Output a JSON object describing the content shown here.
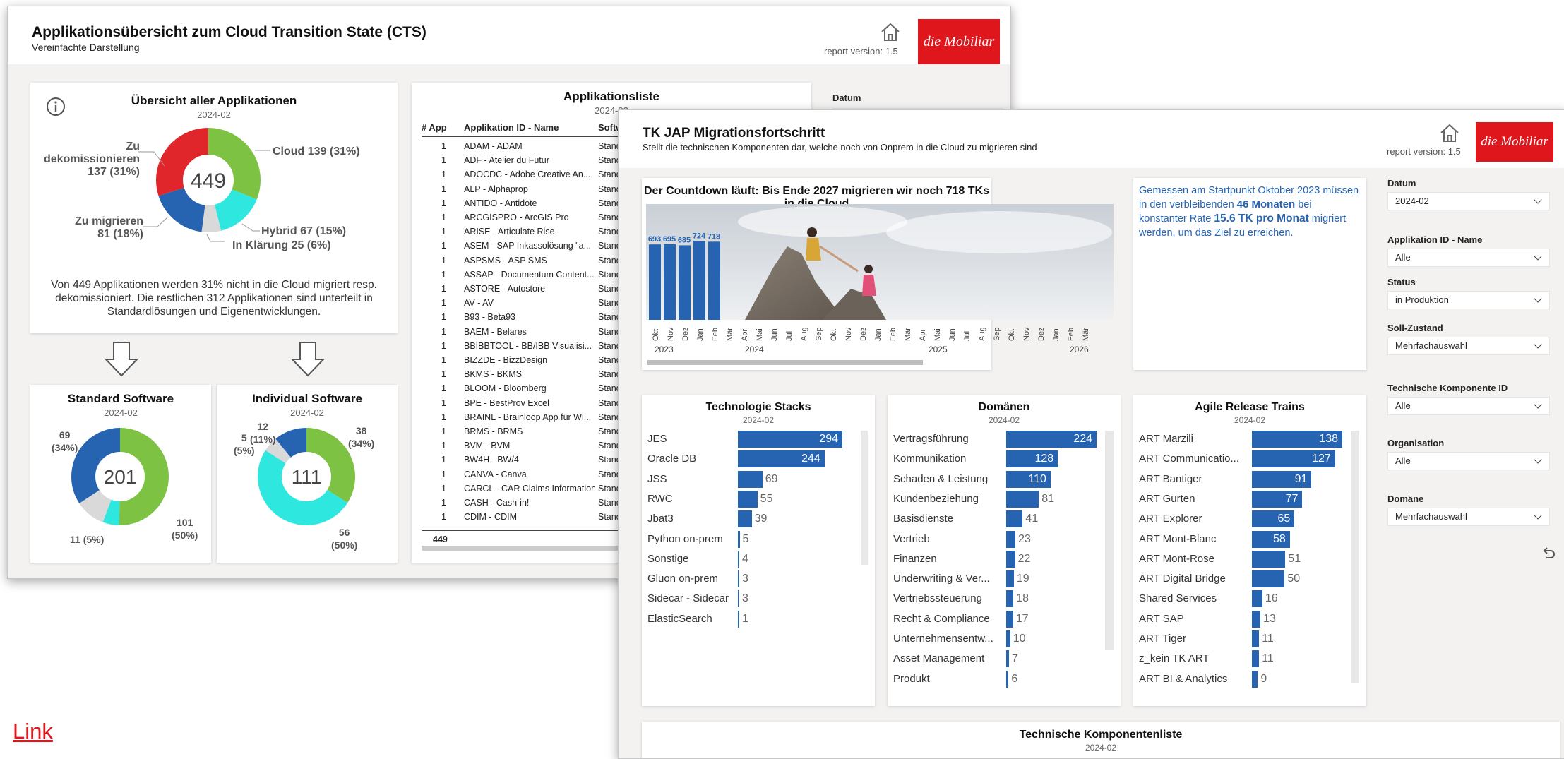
{
  "win1": {
    "title": "Applikationsübersicht zum Cloud Transition State (CTS)",
    "subtitle": "Vereinfachte Darstellung",
    "report_version": "report version: 1.5",
    "logo": "die Mobiliar",
    "overview": {
      "title": "Übersicht aller Applikationen",
      "period": "2024-02",
      "center": "449",
      "labels": {
        "decom": "Zu dekomissionieren",
        "decom_val": "137 (31%)",
        "cloud": "Cloud 139 (31%)",
        "migr": "Zu migrieren",
        "migr_val": "81 (18%)",
        "hybrid": "Hybrid 67 (15%)",
        "klaerung": "In Klärung 25 (6%)"
      },
      "text": "Von 449 Applikationen werden 31% nicht in die Cloud migriert resp. dekomissioniert. Die restlichen 312 Applikationen sind unterteilt in Standardlösungen und Eigenentwicklungen."
    },
    "standard": {
      "title": "Standard Software",
      "period": "2024-02",
      "center": "201",
      "l1a": "69",
      "l1b": "(34%)",
      "l2a": "101",
      "l2b": "(50%)",
      "l3": "11 (5%)"
    },
    "individual": {
      "title": "Individual Software",
      "period": "2024-02",
      "center": "111",
      "l1a": "12",
      "l1b": "(11%)",
      "l2a": "5",
      "l2b": "(5%)",
      "l3a": "38",
      "l3b": "(34%)",
      "l4a": "56",
      "l4b": "(50%)"
    },
    "applist": {
      "title": "Applikationsliste",
      "period": "2024-02",
      "col_app": "# App",
      "col_name": "Applikation ID - Name",
      "col_sw": "Softw",
      "total": "449",
      "rows": [
        {
          "n": "1",
          "name": "ADAM - ADAM",
          "sw": "Standa"
        },
        {
          "n": "1",
          "name": "ADF - Atelier du Futur",
          "sw": "Standa"
        },
        {
          "n": "1",
          "name": "ADOCDC - Adobe Creative An...",
          "sw": "Standa"
        },
        {
          "n": "1",
          "name": "ALP - Alphaprop",
          "sw": "Standa"
        },
        {
          "n": "1",
          "name": "ANTIDO - Antidote",
          "sw": "Standa"
        },
        {
          "n": "1",
          "name": "ARCGISPRO - ArcGIS Pro",
          "sw": "Standa"
        },
        {
          "n": "1",
          "name": "ARISE - Articulate Rise",
          "sw": "Standa"
        },
        {
          "n": "1",
          "name": "ASEM - SAP Inkassolösung \"a...",
          "sw": "Standa"
        },
        {
          "n": "1",
          "name": "ASPSMS - ASP SMS",
          "sw": "Standa"
        },
        {
          "n": "1",
          "name": "ASSAP - Documentum Content...",
          "sw": "Standa"
        },
        {
          "n": "1",
          "name": "ASTORE - Autostore",
          "sw": "Standa"
        },
        {
          "n": "1",
          "name": "AV - AV",
          "sw": "Standa"
        },
        {
          "n": "1",
          "name": "B93 - Beta93",
          "sw": "Standa"
        },
        {
          "n": "1",
          "name": "BAEM - Belares",
          "sw": "Standa"
        },
        {
          "n": "1",
          "name": "BBIBBTOOL - BB/IBB Visualisi...",
          "sw": "Standa"
        },
        {
          "n": "1",
          "name": "BIZZDE - BizzDesign",
          "sw": "Standa"
        },
        {
          "n": "1",
          "name": "BKMS - BKMS",
          "sw": "Standa"
        },
        {
          "n": "1",
          "name": "BLOOM - Bloomberg",
          "sw": "Standa"
        },
        {
          "n": "1",
          "name": "BPE - BestProv Excel",
          "sw": "Standa"
        },
        {
          "n": "1",
          "name": "BRAINL - Brainloop App für Wi...",
          "sw": "Standa"
        },
        {
          "n": "1",
          "name": "BRMS - BRMS",
          "sw": "Standa"
        },
        {
          "n": "1",
          "name": "BVM - BVM",
          "sw": "Standa"
        },
        {
          "n": "1",
          "name": "BW4H - BW/4",
          "sw": "Standa"
        },
        {
          "n": "1",
          "name": "CANVA - Canva",
          "sw": "Standa"
        },
        {
          "n": "1",
          "name": "CARCL - CAR Claims Information",
          "sw": "Standa"
        },
        {
          "n": "1",
          "name": "CASH - Cash-in!",
          "sw": "Standa"
        },
        {
          "n": "1",
          "name": "CDIM - CDIM",
          "sw": "Standa"
        }
      ]
    },
    "datum_label": "Datum"
  },
  "win2": {
    "title": "TK JAP Migrationsfortschritt",
    "subtitle": "Stellt die technischen Komponenten dar, welche noch von Onprem in die Cloud zu migrieren sind",
    "report_version": "report version: 1.5",
    "logo": "die Mobiliar",
    "countdown": {
      "title": "Der Countdown läuft: Bis Ende 2027 migrieren wir noch 718 TKs in die Cloud",
      "bar_labels": [
        "693",
        "695",
        "685",
        "724",
        "718"
      ],
      "months": [
        "Okt",
        "Nov",
        "Dez",
        "Jan",
        "Feb",
        "Mär",
        "Apr",
        "Mai",
        "Jun",
        "Jul",
        "Aug",
        "Sep",
        "Okt",
        "Nov",
        "Dez",
        "Jan",
        "Feb",
        "Mär",
        "Apr",
        "Mai",
        "Jun",
        "Jul",
        "Aug",
        "Sep",
        "Okt",
        "Nov",
        "Dez",
        "Jan",
        "Feb",
        "Mär"
      ],
      "years": [
        "2023",
        "2024",
        "2025",
        "2026"
      ]
    },
    "info": {
      "t1": "Gemessen am Startpunkt Oktober 2023 müssen in den verbleibenden ",
      "b1": "46 Monaten",
      "t2": " bei konstanter Rate ",
      "b2": "15.6 TK pro Monat",
      "t3": " migriert werden, um das Ziel zu erreichen."
    },
    "filters": [
      {
        "label": "Datum",
        "value": "2024-02"
      },
      {
        "label": "Applikation ID - Name",
        "value": "Alle"
      },
      {
        "label": "Status",
        "value": "in Produktion"
      },
      {
        "label": "Soll-Zustand",
        "value": "Mehrfachauswahl"
      },
      {
        "label": "Technische Komponente ID",
        "value": "Alle"
      },
      {
        "label": "Organisation",
        "value": "Alle"
      },
      {
        "label": "Domäne",
        "value": "Mehrfachauswahl"
      }
    ],
    "stacks": {
      "title": "Technologie Stacks",
      "period": "2024-02",
      "items": [
        {
          "label": "JES",
          "value": 294
        },
        {
          "label": "Oracle DB",
          "value": 244
        },
        {
          "label": "JSS",
          "value": 69
        },
        {
          "label": "RWC",
          "value": 55
        },
        {
          "label": "Jbat3",
          "value": 39
        },
        {
          "label": "Python on-prem",
          "value": 5
        },
        {
          "label": "Sonstige",
          "value": 4
        },
        {
          "label": "Gluon on-prem",
          "value": 3
        },
        {
          "label": "Sidecar - Sidecar",
          "value": 3
        },
        {
          "label": "ElasticSearch",
          "value": 1
        }
      ]
    },
    "domains": {
      "title": "Domänen",
      "period": "2024-02",
      "items": [
        {
          "label": "Vertragsführung",
          "value": 224
        },
        {
          "label": "Kommunikation",
          "value": 128
        },
        {
          "label": "Schaden & Leistung",
          "value": 110
        },
        {
          "label": "Kundenbeziehung",
          "value": 81
        },
        {
          "label": "Basisdienste",
          "value": 41
        },
        {
          "label": "Vertrieb",
          "value": 23
        },
        {
          "label": "Finanzen",
          "value": 22
        },
        {
          "label": "Underwriting & Ver...",
          "value": 19
        },
        {
          "label": "Vertriebssteuerung",
          "value": 18
        },
        {
          "label": "Recht & Compliance",
          "value": 17
        },
        {
          "label": "Unternehmensentw...",
          "value": 10
        },
        {
          "label": "Asset Management",
          "value": 7
        },
        {
          "label": "Produkt",
          "value": 6
        }
      ]
    },
    "arts": {
      "title": "Agile Release Trains",
      "period": "2024-02",
      "items": [
        {
          "label": "ART Marzili",
          "value": 138
        },
        {
          "label": "ART Communicatio...",
          "value": 127
        },
        {
          "label": "ART Bantiger",
          "value": 91
        },
        {
          "label": "ART Gurten",
          "value": 77
        },
        {
          "label": "ART Explorer",
          "value": 65
        },
        {
          "label": "ART Mont-Blanc",
          "value": 58
        },
        {
          "label": "ART Mont-Rose",
          "value": 51
        },
        {
          "label": "ART Digital Bridge",
          "value": 50
        },
        {
          "label": "Shared Services",
          "value": 16
        },
        {
          "label": "ART SAP",
          "value": 13
        },
        {
          "label": "ART Tiger",
          "value": 11
        },
        {
          "label": "z_kein TK ART",
          "value": 11
        },
        {
          "label": "ART BI & Analytics",
          "value": 9
        }
      ]
    },
    "techlist": {
      "title": "Technische Komponentenliste",
      "period": "2024-02"
    }
  },
  "link_text": "Link",
  "colors": {
    "brand_red": "#e0161d",
    "bar_blue": "#2663b0",
    "cloud_green": "#7dc242",
    "hybrid_cyan": "#2ee8e0",
    "decom_red": "#e0262b",
    "grey": "#d9d9d9"
  }
}
